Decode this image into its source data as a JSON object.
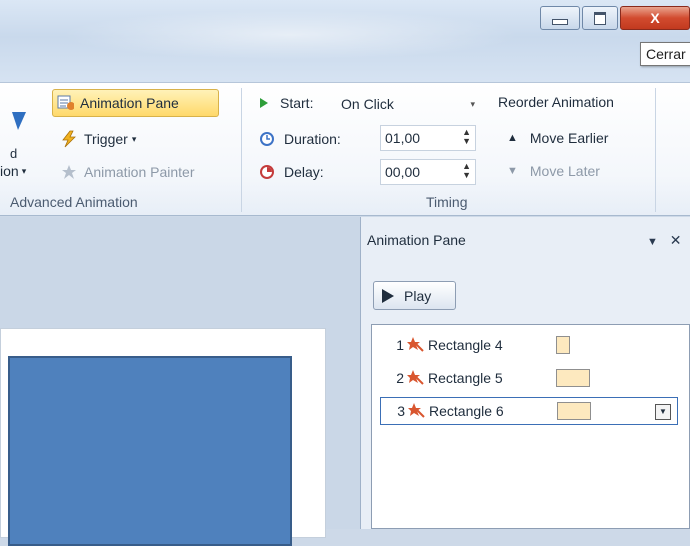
{
  "window": {
    "minimize_icon": "minimize-icon",
    "maximize_icon": "restore-icon",
    "close_icon": "close-icon",
    "close_glyph": "X",
    "close_tooltip": "Cerrar"
  },
  "ribbon": {
    "advanced_animation": {
      "partial_left_text": "d",
      "add_animation_partial": "ion",
      "animation_pane": "Animation Pane",
      "trigger": "Trigger",
      "animation_painter": "Animation Painter",
      "group_label": "Advanced Animation"
    },
    "timing": {
      "start_label": "Start:",
      "start_value": "On Click",
      "duration_label": "Duration:",
      "duration_value": "01,00",
      "delay_label": "Delay:",
      "delay_value": "00,00",
      "group_label": "Timing",
      "reorder_title": "Reorder Animation",
      "move_earlier": "Move Earlier",
      "move_later": "Move Later"
    }
  },
  "animation_pane": {
    "title": "Animation Pane",
    "play_label": "Play",
    "items": [
      {
        "number": "1",
        "name": "Rectangle 4",
        "icon": "entrance-effect-star-icon"
      },
      {
        "number": "2",
        "name": "Rectangle 5",
        "icon": "entrance-effect-star-icon"
      },
      {
        "number": "3",
        "name": "Rectangle 6",
        "icon": "entrance-effect-star-icon",
        "selected": true
      }
    ]
  },
  "colors": {
    "accent_blue": "#4f81bd",
    "close_red": "#d24b2f",
    "highlight": "#ffd96b",
    "timeline_bar": "#fde9bf"
  }
}
